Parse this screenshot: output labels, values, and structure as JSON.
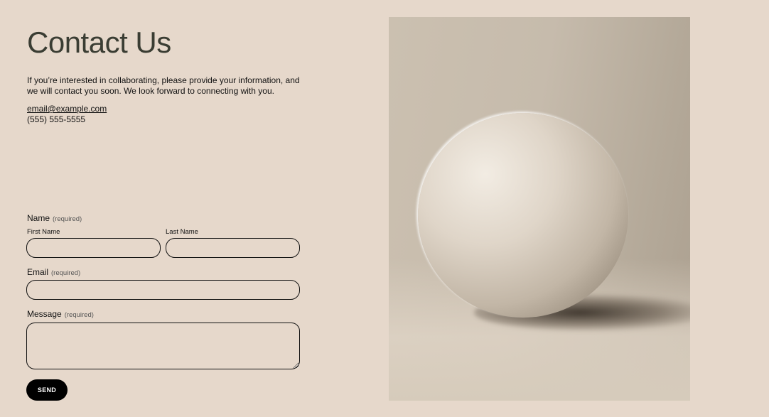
{
  "page": {
    "heading": "Contact Us",
    "intro": "If you’re interested in collaborating, please provide your information, and we will contact you soon. We look forward to connecting with you.",
    "email": "email@example.com",
    "phone": "(555) 555-5555"
  },
  "form": {
    "name": {
      "label": "Name",
      "required": "(required)",
      "first_label": "First Name",
      "first_value": "",
      "last_label": "Last Name",
      "last_value": ""
    },
    "email": {
      "label": "Email",
      "required": "(required)",
      "value": ""
    },
    "message": {
      "label": "Message",
      "required": "(required)",
      "value": ""
    },
    "send_label": "SEND"
  },
  "image": {
    "subject": "sphere-photo"
  },
  "colors": {
    "background": "#e6d8cb",
    "heading": "#3a3d33",
    "button_bg": "#000000",
    "button_text": "#ffffff"
  }
}
